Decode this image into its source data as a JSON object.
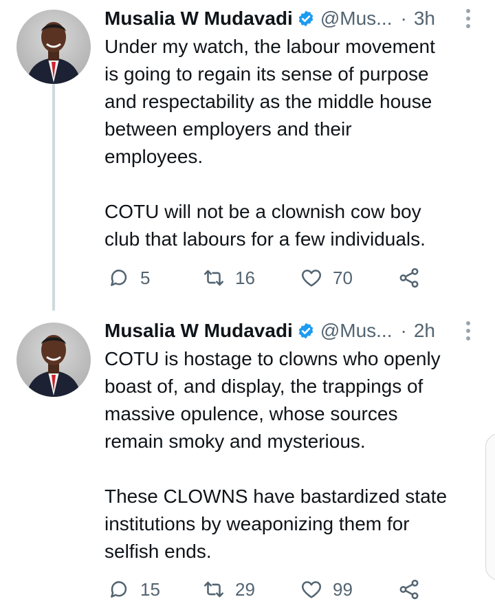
{
  "colors": {
    "text": "#0f1419",
    "muted": "#536471",
    "verified": "#1d9bf0",
    "thread_line": "#cfd9de"
  },
  "icons": {
    "reply": "reply-icon",
    "retweet": "retweet-icon",
    "like": "heart-icon",
    "share": "share-icon",
    "verified": "verified-badge-icon",
    "more": "more-vertical-icon"
  },
  "tweets": [
    {
      "name": "Musalia W Mudavadi",
      "handle": "@Mus...",
      "separator": "·",
      "time": "3h",
      "text": "Under my watch, the labour movement\nis going to regain its sense of purpose\nand respectability as the middle house\nbetween employers and their\nemployees.\n\nCOTU will not be a clownish cow boy\nclub that labours for a few individuals.",
      "replies": "5",
      "retweets": "16",
      "likes": "70"
    },
    {
      "name": "Musalia W Mudavadi",
      "handle": "@Mus...",
      "separator": "·",
      "time": "2h",
      "text": "COTU is hostage to clowns who openly\nboast of, and display, the trappings of\nmassive opulence, whose sources\nremain smoky and mysterious.\n\nThese CLOWNS have bastardized state\ninstitutions by weaponizing them for\nselfish ends.",
      "replies": "15",
      "retweets": "29",
      "likes": "99"
    }
  ]
}
